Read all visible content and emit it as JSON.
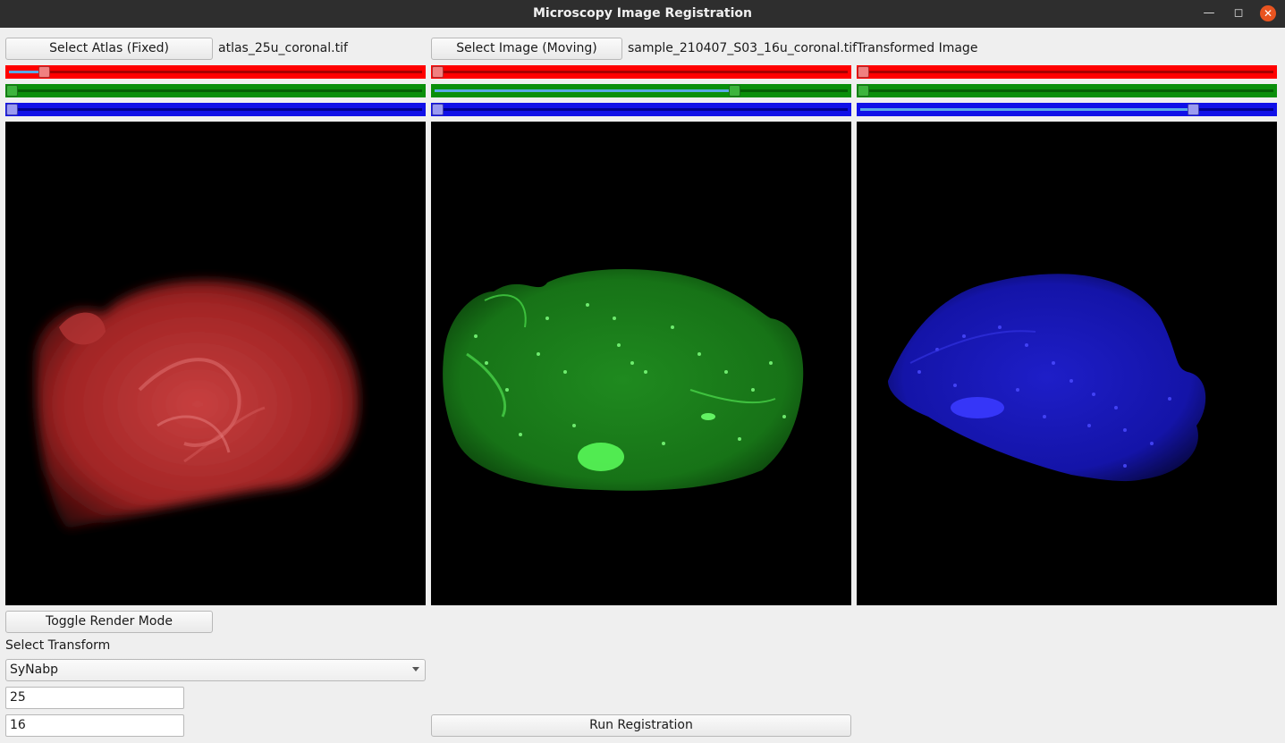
{
  "window": {
    "title": "Microscopy Image Registration",
    "minimize_icon": "minimize-icon",
    "maximize_icon": "maximize-icon",
    "close_icon": "close-icon"
  },
  "panels": {
    "fixed": {
      "button_label": "Select Atlas (Fixed)",
      "filename": "atlas_25u_coronal.tif",
      "sliders": {
        "red": 0.08,
        "green": 0.0,
        "blue": 0.0
      }
    },
    "moving": {
      "button_label": "Select Image (Moving)",
      "filename": "sample_210407_S03_16u_coronal.tif",
      "sliders": {
        "red": 0.0,
        "green": 0.73,
        "blue": 0.0
      }
    },
    "transformed": {
      "label": "Transformed Image",
      "sliders": {
        "red": 0.0,
        "green": 0.0,
        "blue": 0.81
      }
    }
  },
  "controls": {
    "toggle_render_label": "Toggle Render Mode",
    "transform_label": "Select Transform",
    "transform_value": "SyNabp",
    "fixed_resolution": "25",
    "moving_resolution": "16",
    "run_label": "Run Registration"
  },
  "colors": {
    "red_channel": "#ff0000",
    "green_channel": "#0a8f0a",
    "blue_channel": "#1010e8"
  }
}
